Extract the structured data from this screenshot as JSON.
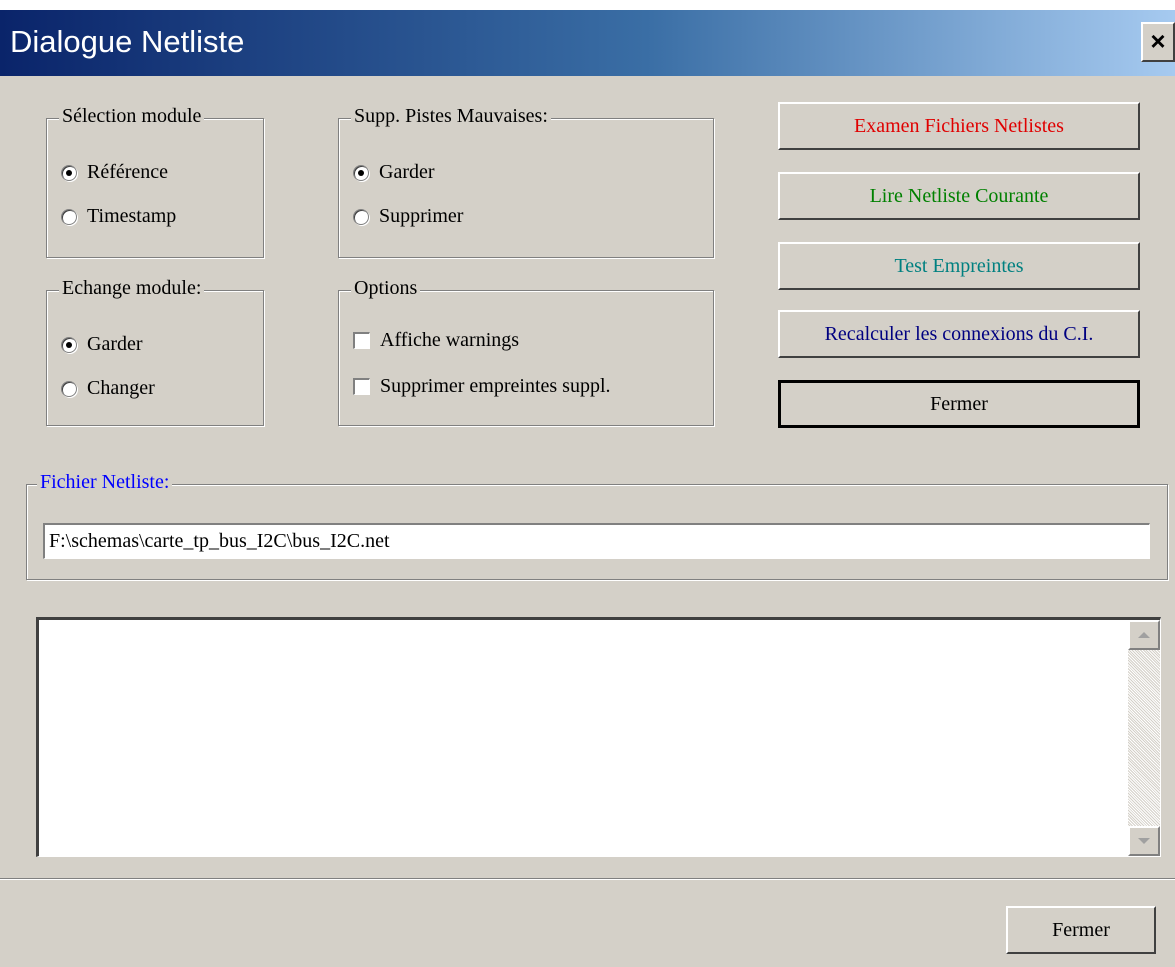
{
  "window": {
    "title": "Dialogue Netliste",
    "close_label": "×"
  },
  "module_selection": {
    "title": "Sélection module",
    "options": [
      {
        "label": "Référence",
        "selected": true
      },
      {
        "label": "Timestamp",
        "selected": false
      }
    ]
  },
  "bad_tracks": {
    "title": "Supp. Pistes Mauvaises:",
    "options": [
      {
        "label": "Garder",
        "selected": true
      },
      {
        "label": "Supprimer",
        "selected": false
      }
    ]
  },
  "module_exchange": {
    "title": "Echange module:",
    "options": [
      {
        "label": "Garder",
        "selected": true
      },
      {
        "label": "Changer",
        "selected": false
      }
    ]
  },
  "options": {
    "title": "Options",
    "checkboxes": [
      {
        "label": "Affiche warnings",
        "checked": false
      },
      {
        "label": "Supprimer empreintes suppl.",
        "checked": false
      }
    ]
  },
  "actions": {
    "examine": {
      "label": "Examen Fichiers Netlistes",
      "color": "#e00000"
    },
    "read_netlist": {
      "label": "Lire Netliste Courante",
      "color": "#008000"
    },
    "test_footprints": {
      "label": "Test Empreintes",
      "color": "#008080"
    },
    "recalc": {
      "label": "Recalculer les connexions du C.I.",
      "color": "#000080"
    },
    "close": {
      "label": "Fermer",
      "color": "#000000"
    }
  },
  "netlist_file": {
    "title": "Fichier Netliste:",
    "title_color": "#0000ff",
    "value": "F:\\schemas\\carte_tp_bus_I2C\\bus_I2C.net"
  },
  "messages": {
    "content": ""
  },
  "footer": {
    "close_label": "Fermer"
  }
}
